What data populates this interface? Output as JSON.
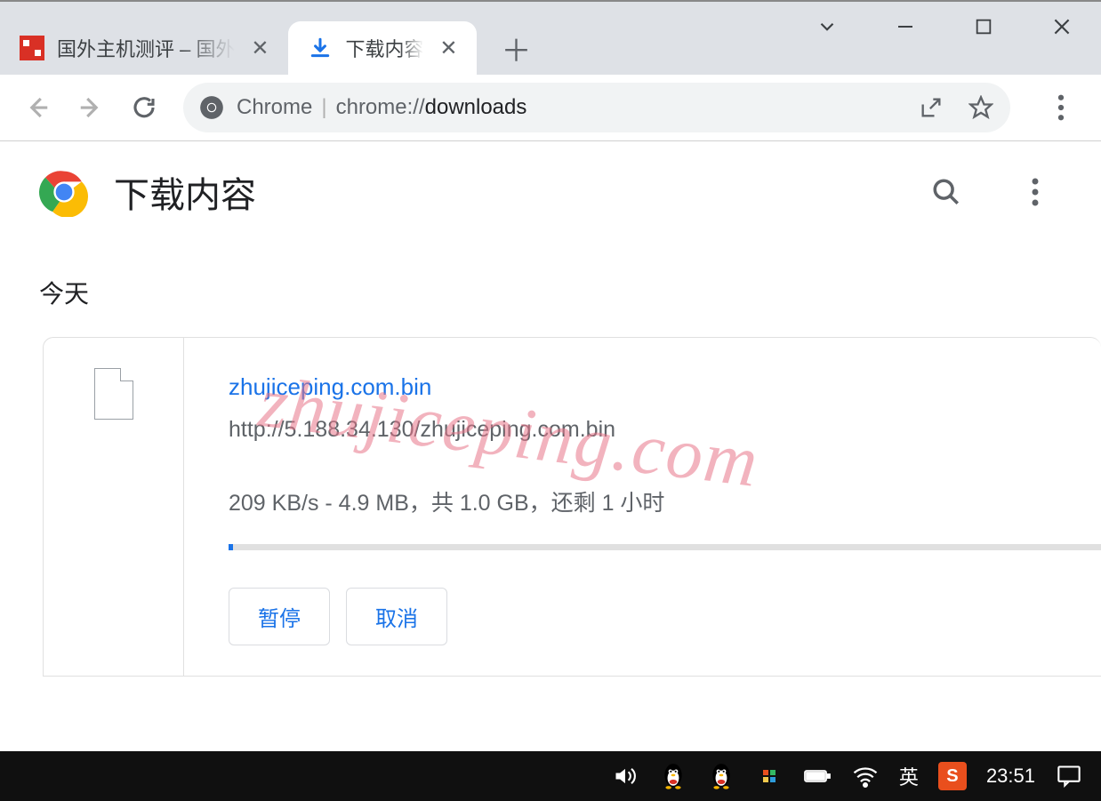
{
  "tabs": {
    "inactive_title": "国外主机测评 – 国外",
    "active_title": "下载内容"
  },
  "toolbar": {
    "chrome_label": "Chrome",
    "url_prefix": "chrome://",
    "url_dark": "downloads"
  },
  "page": {
    "title": "下载内容",
    "section_today": "今天"
  },
  "download": {
    "filename": "zhujiceping.com.bin",
    "url": "http://5.188.34.130/zhujiceping.com.bin",
    "status": "209 KB/s - 4.9 MB，共 1.0 GB，还剩 1 小时",
    "btn_pause": "暂停",
    "btn_cancel": "取消"
  },
  "watermark": "zhujiceping.com",
  "taskbar": {
    "ime_lang": "英",
    "ime_badge": "S",
    "clock": "23:51"
  }
}
